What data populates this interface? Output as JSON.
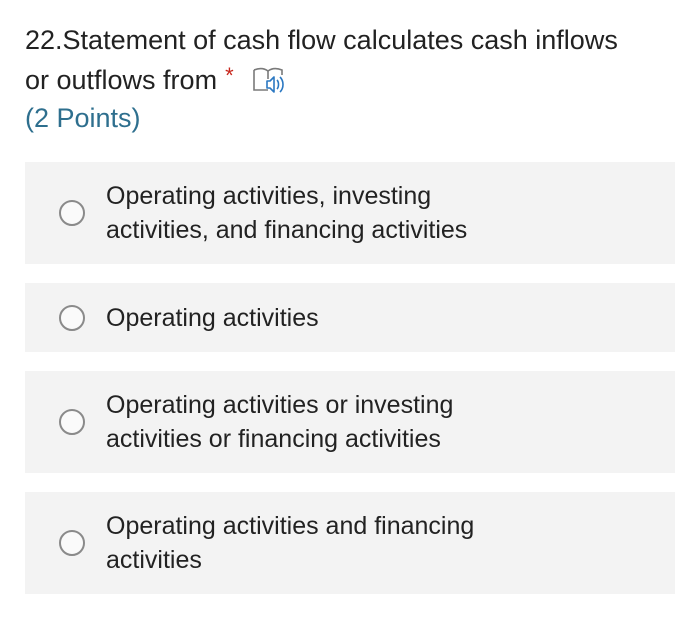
{
  "question": {
    "number": "22.",
    "line1": "Statement of cash flow calculates cash inflows",
    "line2": "or outflows from",
    "required_mark": "*",
    "reader_icon": "immersive-reader-icon",
    "points": "(2 Points)"
  },
  "options": [
    {
      "label": "Operating activities, investing activities, and financing activities",
      "selected": false
    },
    {
      "label": "Operating activities",
      "selected": false
    },
    {
      "label": "Operating activities or investing activities or financing activities",
      "selected": false
    },
    {
      "label": "Operating activities and financing activities",
      "selected": false
    }
  ],
  "colors": {
    "required": "#c7261c",
    "points": "#2e6f8e",
    "option_background": "#f3f3f3"
  }
}
